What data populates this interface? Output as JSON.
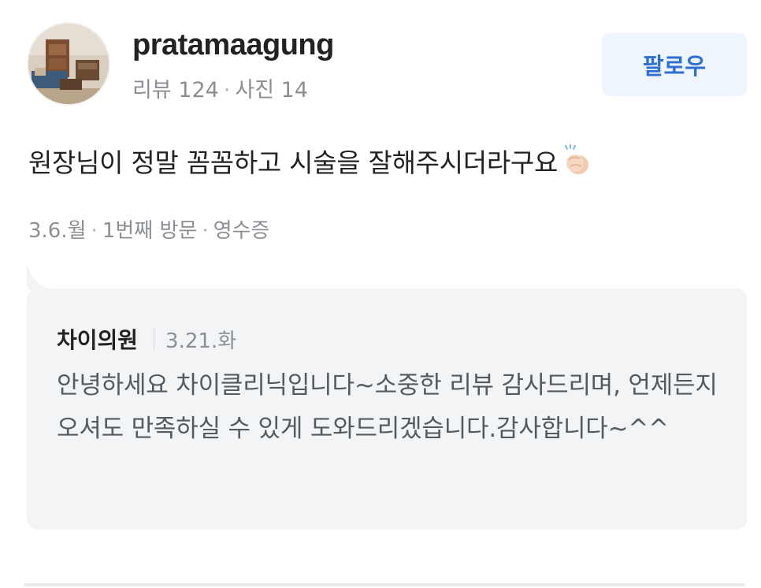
{
  "reviewer": {
    "username": "pratamaagung",
    "reviews_label": "리뷰 124",
    "photos_label": "사진 14",
    "separator": "·",
    "avatar_icon": "room-photo-avatar"
  },
  "follow_button": {
    "label": "팔로우",
    "color": "#2f6fd1",
    "background": "#eef5fd"
  },
  "review": {
    "text": "원장님이 정말 꼼꼼하고 시술을 잘해주시더라구요",
    "emoji_icon": "clapping-hands-icon"
  },
  "visit_info": {
    "date": "3.6.월",
    "visit_count": "1번째 방문",
    "verification": "영수증",
    "separator": "·"
  },
  "owner_reply": {
    "author": "차이의원",
    "date": "3.21.화",
    "body": "안녕하세요 차이클리닉입니다~소중한 리뷰 감사드리며, 언제든지 오셔도 만족하실 수 있게 도와드리겠습니다.감사합니다~^^"
  }
}
